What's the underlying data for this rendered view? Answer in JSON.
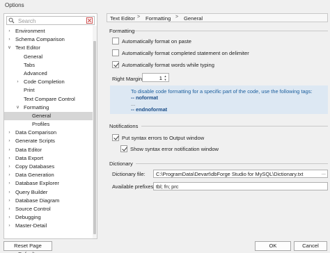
{
  "window": {
    "title": "Options"
  },
  "search": {
    "placeholder": "Search",
    "value": ""
  },
  "tree": [
    {
      "label": "Environment",
      "level": 0,
      "expander": "collapsed"
    },
    {
      "label": "Schema Comparison",
      "level": 0,
      "expander": "collapsed"
    },
    {
      "label": "Text Editor",
      "level": 0,
      "expander": "expanded"
    },
    {
      "label": "General",
      "level": 1,
      "expander": "none"
    },
    {
      "label": "Tabs",
      "level": 1,
      "expander": "none"
    },
    {
      "label": "Advanced",
      "level": 1,
      "expander": "none"
    },
    {
      "label": "Code Completion",
      "level": 1,
      "expander": "collapsed"
    },
    {
      "label": "Print",
      "level": 1,
      "expander": "none"
    },
    {
      "label": "Text Compare Control",
      "level": 1,
      "expander": "none"
    },
    {
      "label": "Formatting",
      "level": 1,
      "expander": "expanded"
    },
    {
      "label": "General",
      "level": 2,
      "expander": "none",
      "selected": true
    },
    {
      "label": "Profiles",
      "level": 2,
      "expander": "none"
    },
    {
      "label": "Data Comparison",
      "level": 0,
      "expander": "collapsed"
    },
    {
      "label": "Generate Scripts",
      "level": 0,
      "expander": "collapsed"
    },
    {
      "label": "Data Editor",
      "level": 0,
      "expander": "collapsed"
    },
    {
      "label": "Data Export",
      "level": 0,
      "expander": "collapsed"
    },
    {
      "label": "Copy Databases",
      "level": 0,
      "expander": "collapsed"
    },
    {
      "label": "Data Generation",
      "level": 0,
      "expander": "collapsed"
    },
    {
      "label": "Database Explorer",
      "level": 0,
      "expander": "collapsed"
    },
    {
      "label": "Query Builder",
      "level": 0,
      "expander": "collapsed"
    },
    {
      "label": "Database Diagram",
      "level": 0,
      "expander": "collapsed"
    },
    {
      "label": "Source Control",
      "level": 0,
      "expander": "collapsed"
    },
    {
      "label": "Debugging",
      "level": 0,
      "expander": "collapsed"
    },
    {
      "label": "Master-Detail",
      "level": 0,
      "expander": "collapsed"
    }
  ],
  "breadcrumb": [
    "Text Editor",
    "Formatting",
    "General"
  ],
  "formatting": {
    "heading": "Formatting",
    "auto_format_paste": {
      "label": "Automatically format on paste",
      "checked": false
    },
    "auto_format_delimiter": {
      "label": "Automatically format completed statement on delimiter",
      "checked": false
    },
    "auto_format_typing": {
      "label": "Automatically format words while typing",
      "checked": true
    },
    "right_margin_label": "Right Margin:",
    "right_margin_value": "1"
  },
  "info": {
    "message": "To disable code formatting for a specific part of the code, use the following tags:",
    "noformat": "-- noformat",
    "ellipsis": "...",
    "endnoformat": "-- endnoformat"
  },
  "notifications": {
    "heading": "Notifications",
    "put_errors": {
      "label": "Put syntax errors to Output window",
      "checked": true
    },
    "show_notification": {
      "label": "Show syntax error notification window",
      "checked": true
    }
  },
  "dictionary": {
    "heading": "Dictionary",
    "file_label": "Dictionary file:",
    "file_value": "C:\\ProgramData\\Devart\\dbForge Studio for MySQL\\Dictionary.txt",
    "browse_label": "...",
    "prefixes_label": "Available prefixes:",
    "prefixes_value": "tbl; fn; prc"
  },
  "buttons": {
    "reset": "Reset Page Defaults",
    "ok": "OK",
    "cancel": "Cancel"
  },
  "colors": {
    "selected_bg": "#d6d6d6",
    "info_bg": "#dde8f3",
    "info_text": "#1a5d9c"
  }
}
